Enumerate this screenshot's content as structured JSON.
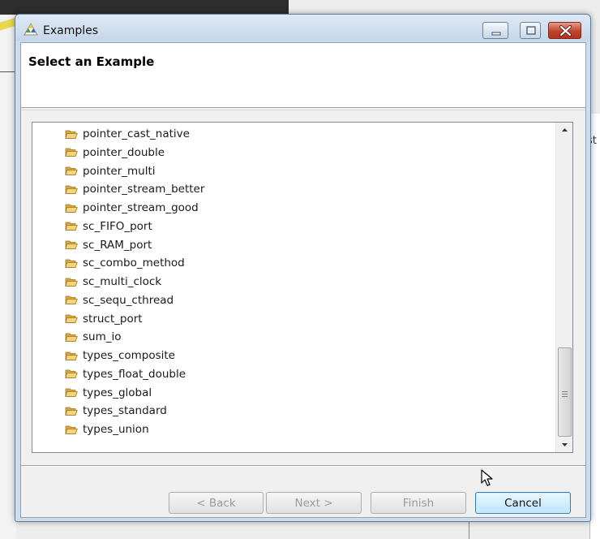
{
  "background": {
    "right_text": "st"
  },
  "window": {
    "title": "Examples",
    "controls": {
      "minimize_icon": "minimize-icon",
      "maximize_icon": "maximize-icon",
      "close_icon": "close-icon"
    }
  },
  "header": {
    "title": "Select an Example"
  },
  "tree": {
    "folder_icon": "folder-open-icon",
    "items": [
      "pointer_cast_native",
      "pointer_double",
      "pointer_multi",
      "pointer_stream_better",
      "pointer_stream_good",
      "sc_FIFO_port",
      "sc_RAM_port",
      "sc_combo_method",
      "sc_multi_clock",
      "sc_sequ_cthread",
      "struct_port",
      "sum_io",
      "types_composite",
      "types_float_double",
      "types_global",
      "types_standard",
      "types_union"
    ]
  },
  "buttons": {
    "back": "< Back",
    "next": "Next >",
    "finish": "Finish",
    "cancel": "Cancel"
  },
  "colors": {
    "titlebar": "#cfdcea",
    "close_button": "#c0432e",
    "folder": "#e8c25a",
    "cancel_focus": "#3c7fb1"
  }
}
